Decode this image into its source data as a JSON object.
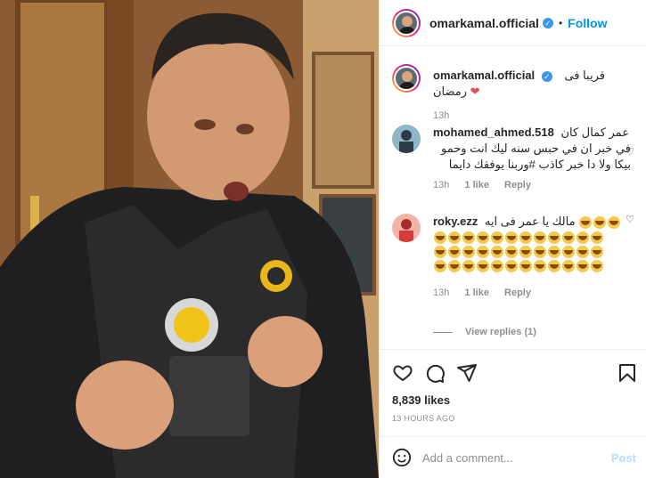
{
  "post": {
    "username": "omarkamal.official",
    "follow_label": "Follow",
    "dot": "•",
    "caption": "قريبا فى رمضان",
    "caption_time": "13h",
    "likes": "8,839 likes",
    "time_ago": "13 HOURS AGO",
    "add_comment_placeholder": "Add a comment...",
    "post_label": "Post"
  },
  "comments": [
    {
      "username": "mohamed_ahmed.518",
      "text_lead": "عمر كمال كان",
      "text": "في خبر ان في حبس سنه ليك انت وحمو بيكا ولا دا خبر كاذب #وربنا يوفقك دايما",
      "hashtag": "#وربنا",
      "time": "13h",
      "likes": "1 like",
      "reply": "Reply"
    },
    {
      "username": "roky.ezz",
      "text": "مالك يا عمر فى ايه",
      "emoji_count_line1": 3,
      "emoji_total": 39,
      "time": "13h",
      "likes": "1 like",
      "reply": "Reply",
      "view_replies": "View replies (1)"
    }
  ],
  "icons": [
    "heart-icon",
    "comment-icon",
    "share-icon",
    "bookmark-icon",
    "emoji-icon",
    "verified-badge"
  ],
  "colors": {
    "accent": "#0095f6",
    "verified": "#3897f0",
    "muted": "#8e8e8e",
    "like_heart": "#ed4956"
  }
}
